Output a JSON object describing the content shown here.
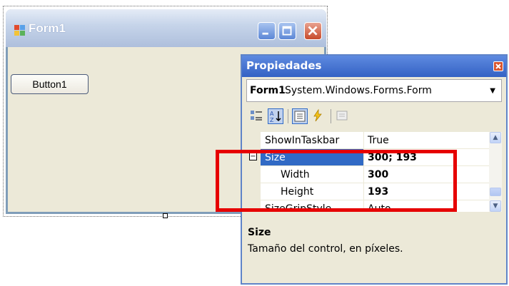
{
  "form": {
    "title": "Form1",
    "button_label": "Button1"
  },
  "properties": {
    "window_title": "Propiedades",
    "object_name": "Form1",
    "object_type": "System.Windows.Forms.Form",
    "rows": [
      {
        "name": "ShowInTaskbar",
        "value": "True"
      },
      {
        "name": "Size",
        "value": "300; 193",
        "expander": "−"
      },
      {
        "name": "Width",
        "value": "300"
      },
      {
        "name": "Height",
        "value": "193"
      },
      {
        "name": "SizeGripStyle",
        "value": "Auto"
      }
    ],
    "description_title": "Size",
    "description_text": "Tamaño del control, en píxeles."
  },
  "colors": {
    "highlight": "#e60000",
    "selection": "#316ac5",
    "titlebar": "#3462c4"
  }
}
